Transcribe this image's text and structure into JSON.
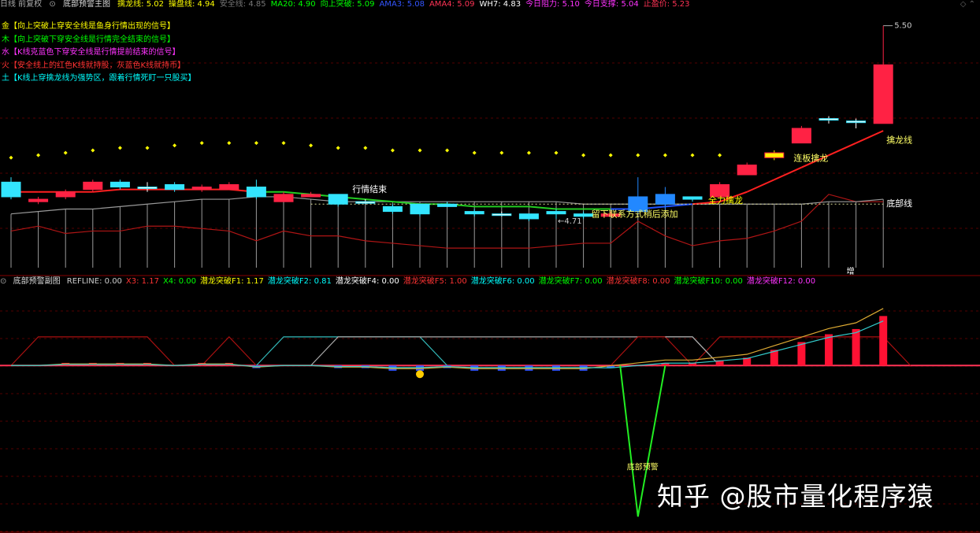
{
  "header": {
    "prefix": "日线 前复权",
    "title": "底部预警主图",
    "items": [
      {
        "label": "擒龙线: 5.02",
        "color": "#ffff00"
      },
      {
        "label": "操盘线: 4.94",
        "color": "#ffff00"
      },
      {
        "label": "安全线: 4.85",
        "color": "#777777"
      },
      {
        "label": "MA20: 4.90",
        "color": "#00ff00"
      },
      {
        "label": "向上突破: 5.09",
        "color": "#00ff00"
      },
      {
        "label": "AMA3: 5.08",
        "color": "#3355ff"
      },
      {
        "label": "AMA4: 5.09",
        "color": "#ff3355"
      },
      {
        "label": "WH7: 4.83",
        "color": "#ffffff"
      },
      {
        "label": "今日阻力: 5.10",
        "color": "#ff33ff"
      },
      {
        "label": "今日支撑: 5.04",
        "color": "#ff33ff"
      },
      {
        "label": "止盈价: 5.23",
        "color": "#ff3355"
      }
    ]
  },
  "signals": [
    {
      "text": "金【向上突破上穿安全线是鱼身行情出现的信号】",
      "color": "#ffff00"
    },
    {
      "text": "木【向上突破下穿安全线是行情完全结束的信号】",
      "color": "#00ff00"
    },
    {
      "text": "水【K线克蓝色下穿安全线是行情提前结束的信号】",
      "color": "#ff33ff"
    },
    {
      "text": "火【安全线上的红色K线就持股，灰蓝色K线就持币】",
      "color": "#ff3333"
    },
    {
      "text": "土【K线上穿擒龙线为强势区，跟着行情死盯一只股买】",
      "color": "#00ffff"
    }
  ],
  "annotations": {
    "high_price": "5.50",
    "low_price": "←4.71",
    "end_label": "行情结束",
    "hint": "留下联系方式稍后添加",
    "rise": "全力擒龙",
    "consecutive": "连板擒龙",
    "qinlong": "擒龙线",
    "dibu": "底部线",
    "zeng": "增",
    "sub_bottom": "底部预警"
  },
  "sub_header": {
    "title": "底部预警副图",
    "items": [
      {
        "label": "REFLINE: 0.00",
        "color": "#cccccc"
      },
      {
        "label": "X3: 1.17",
        "color": "#ff3333"
      },
      {
        "label": "X4: 0.00",
        "color": "#00ff00"
      },
      {
        "label": "潜龙突破F1: 1.17",
        "color": "#ffff00"
      },
      {
        "label": "潜龙突破F2: 0.81",
        "color": "#00ffff"
      },
      {
        "label": "潜龙突破F4: 0.00",
        "color": "#ffffff"
      },
      {
        "label": "潜龙突破F5: 1.00",
        "color": "#ff3333"
      },
      {
        "label": "潜龙突破F6: 0.00",
        "color": "#00ffff"
      },
      {
        "label": "潜龙突破F7: 0.00",
        "color": "#00ff00"
      },
      {
        "label": "潜龙突破F8: 0.00",
        "color": "#ff3333"
      },
      {
        "label": "潜龙突破F10: 0.00",
        "color": "#00ff00"
      },
      {
        "label": "潜龙突破F12: 0.00",
        "color": "#ff33ff"
      }
    ]
  },
  "watermark": "知乎 @股市量化程序猿",
  "chart_data": {
    "type": "candlestick",
    "candles": [
      {
        "o": 4.86,
        "c": 4.8,
        "h": 4.88,
        "l": 4.79
      },
      {
        "o": 4.78,
        "c": 4.79,
        "h": 4.8,
        "l": 4.77
      },
      {
        "o": 4.8,
        "c": 4.82,
        "h": 4.83,
        "l": 4.79
      },
      {
        "o": 4.83,
        "c": 4.86,
        "h": 4.87,
        "l": 4.82
      },
      {
        "o": 4.86,
        "c": 4.84,
        "h": 4.87,
        "l": 4.83
      },
      {
        "o": 4.84,
        "c": 4.84,
        "h": 4.86,
        "l": 4.82
      },
      {
        "o": 4.85,
        "c": 4.83,
        "h": 4.86,
        "l": 4.82
      },
      {
        "o": 4.83,
        "c": 4.84,
        "h": 4.85,
        "l": 4.82
      },
      {
        "o": 4.83,
        "c": 4.85,
        "h": 4.86,
        "l": 4.83
      },
      {
        "o": 4.84,
        "c": 4.8,
        "h": 4.87,
        "l": 4.79
      },
      {
        "o": 4.78,
        "c": 4.81,
        "h": 4.82,
        "l": 4.78
      },
      {
        "o": 4.8,
        "c": 4.81,
        "h": 4.82,
        "l": 4.8
      },
      {
        "o": 4.81,
        "c": 4.77,
        "h": 4.81,
        "l": 4.76
      },
      {
        "o": 4.78,
        "c": 4.78,
        "h": 4.79,
        "l": 4.77
      },
      {
        "o": 4.76,
        "c": 4.74,
        "h": 4.77,
        "l": 4.73
      },
      {
        "o": 4.77,
        "c": 4.73,
        "h": 4.77,
        "l": 4.72
      },
      {
        "o": 4.77,
        "c": 4.76,
        "h": 4.78,
        "l": 4.76
      },
      {
        "o": 4.74,
        "c": 4.73,
        "h": 4.75,
        "l": 4.72
      },
      {
        "o": 4.73,
        "c": 4.73,
        "h": 4.74,
        "l": 4.72
      },
      {
        "o": 4.73,
        "c": 4.71,
        "h": 4.73,
        "l": 4.7
      },
      {
        "o": 4.74,
        "c": 4.73,
        "h": 4.75,
        "l": 4.71
      },
      {
        "o": 4.73,
        "c": 4.72,
        "h": 4.74,
        "l": 4.71
      },
      {
        "o": 4.72,
        "c": 4.73,
        "h": 4.74,
        "l": 4.72
      },
      {
        "o": 4.8,
        "c": 4.74,
        "h": 4.88,
        "l": 4.73
      },
      {
        "o": 4.81,
        "c": 4.77,
        "h": 4.84,
        "l": 4.75
      },
      {
        "o": 4.8,
        "c": 4.79,
        "h": 4.8,
        "l": 4.78
      },
      {
        "o": 4.8,
        "c": 4.85,
        "h": 4.86,
        "l": 4.8
      },
      {
        "o": 4.89,
        "c": 4.93,
        "h": 4.94,
        "l": 4.89
      },
      {
        "o": 4.96,
        "c": 4.98,
        "h": 4.99,
        "l": 4.95
      },
      {
        "o": 5.02,
        "c": 5.08,
        "h": 5.09,
        "l": 5.02
      },
      {
        "o": 5.12,
        "c": 5.12,
        "h": 5.13,
        "l": 5.1
      },
      {
        "o": 5.11,
        "c": 5.11,
        "h": 5.12,
        "l": 5.08
      },
      {
        "o": 5.1,
        "c": 5.34,
        "h": 5.5,
        "l": 5.1
      }
    ],
    "qinlong_line": [
      4.82,
      4.82,
      4.82,
      4.82,
      4.83,
      4.83,
      4.83,
      4.83,
      4.83,
      4.82,
      4.82,
      4.81,
      4.8,
      4.79,
      4.78,
      4.77,
      4.77,
      4.76,
      4.76,
      4.76,
      4.75,
      4.75,
      4.75,
      4.75,
      4.76,
      4.77,
      4.78,
      4.82,
      4.87,
      4.92,
      4.97,
      5.02,
      5.07
    ],
    "safe_line": [
      4.73,
      4.74,
      4.75,
      4.75,
      4.76,
      4.77,
      4.78,
      4.79,
      4.79,
      4.8,
      4.8,
      4.79,
      4.78,
      4.78,
      4.78,
      4.78,
      4.78,
      4.78,
      4.78,
      4.78,
      4.78,
      4.77,
      4.77,
      4.77,
      4.77,
      4.77,
      4.77,
      4.77,
      4.77,
      4.77,
      4.78,
      4.78,
      4.79
    ],
    "red_line": [
      4.66,
      4.68,
      4.65,
      4.66,
      4.66,
      4.68,
      4.68,
      4.67,
      4.66,
      4.62,
      4.66,
      4.64,
      4.64,
      4.62,
      4.61,
      4.6,
      4.59,
      4.59,
      4.59,
      4.59,
      4.6,
      4.61,
      4.61,
      4.7,
      4.64,
      4.6,
      4.62,
      4.63,
      4.66,
      4.7,
      4.81,
      4.78,
      4.78
    ],
    "stop_dots": [
      4.96,
      4.97,
      4.98,
      4.99,
      5.0,
      5.0,
      5.01,
      5.02,
      5.02,
      5.02,
      5.02,
      5.01,
      5.0,
      5.0,
      4.99,
      4.99,
      4.99,
      4.98,
      4.98,
      4.98,
      4.98,
      4.97,
      4.97,
      4.97,
      4.97,
      4.97,
      4.97
    ],
    "ylim": [
      4.51,
      5.56
    ],
    "sub_ylim": [
      -3.2,
      1.5
    ],
    "sub_trap": [
      0,
      0.55,
      0.55,
      0,
      0,
      0,
      0,
      0.55,
      0,
      0,
      0,
      -0.05,
      -0.05,
      0,
      0,
      0,
      0,
      0,
      0,
      0,
      0,
      0,
      0,
      0.55,
      0.2,
      0,
      0,
      0.55,
      0.55,
      0.55,
      0.55,
      0.55,
      0.55
    ],
    "sub_bars": [
      0,
      0,
      0.05,
      0.05,
      0.05,
      0.05,
      0,
      0.05,
      0.05,
      -0.05,
      0,
      0,
      -0.05,
      -0.05,
      -0.1,
      -0.1,
      -0.05,
      -0.1,
      -0.1,
      -0.1,
      -0.1,
      -0.1,
      -0.05,
      0,
      0.05,
      0.05,
      0.1,
      0.15,
      0.3,
      0.45,
      0.6,
      0.7,
      0.95
    ],
    "sub_spike": -2.9
  }
}
